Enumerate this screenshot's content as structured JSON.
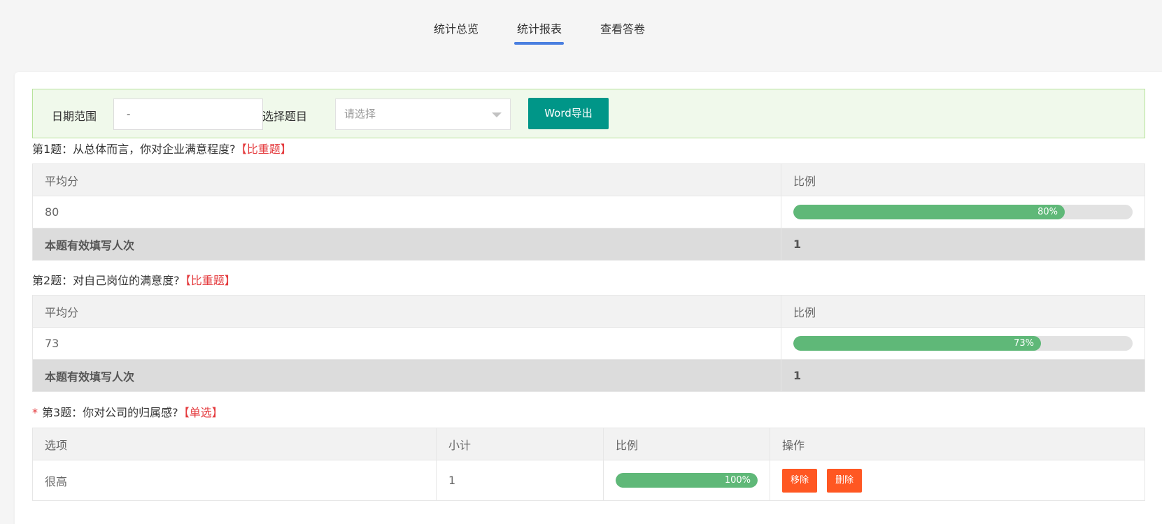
{
  "tabs": [
    {
      "label": "统计总览"
    },
    {
      "label": "统计报表"
    },
    {
      "label": "查看答卷"
    }
  ],
  "filters": {
    "date_label": "日期范围",
    "date_value": "-",
    "question_label": "选择题目",
    "question_placeholder": "请选择",
    "export_label": "Word导出"
  },
  "questions": [
    {
      "title": "第1题：从总体而言，你对企业满意程度?",
      "type": "【比重题】",
      "col_avg": "平均分",
      "col_ratio": "比例",
      "avg": "80",
      "ratio": 0.8,
      "ratio_text": "80%",
      "footer_label": "本题有效填写人次",
      "footer_value": "1"
    },
    {
      "title": "第2题：对自己岗位的满意度?",
      "type": "【比重题】",
      "col_avg": "平均分",
      "col_ratio": "比例",
      "avg": "73",
      "ratio": 0.73,
      "ratio_text": "73%",
      "footer_label": "本题有效填写人次",
      "footer_value": "1"
    },
    {
      "required_mark": "*",
      "title": "第3题：你对公司的归属感?",
      "type": "【单选】",
      "headers": [
        "选项",
        "小计",
        "比例",
        "操作"
      ],
      "rows": [
        {
          "option": "很高",
          "count": "1",
          "ratio": 1.0,
          "ratio_text": "100%",
          "btn_move": "移除",
          "btn_delete": "删除"
        }
      ]
    }
  ],
  "colors": {
    "tab_underline": "#4a7fe0",
    "export_button": "#009688",
    "progress_fill": "#5fb878",
    "action_button": "#ff5722",
    "question_type": "#e4393c",
    "filter_bg": "#f0f9eb"
  }
}
